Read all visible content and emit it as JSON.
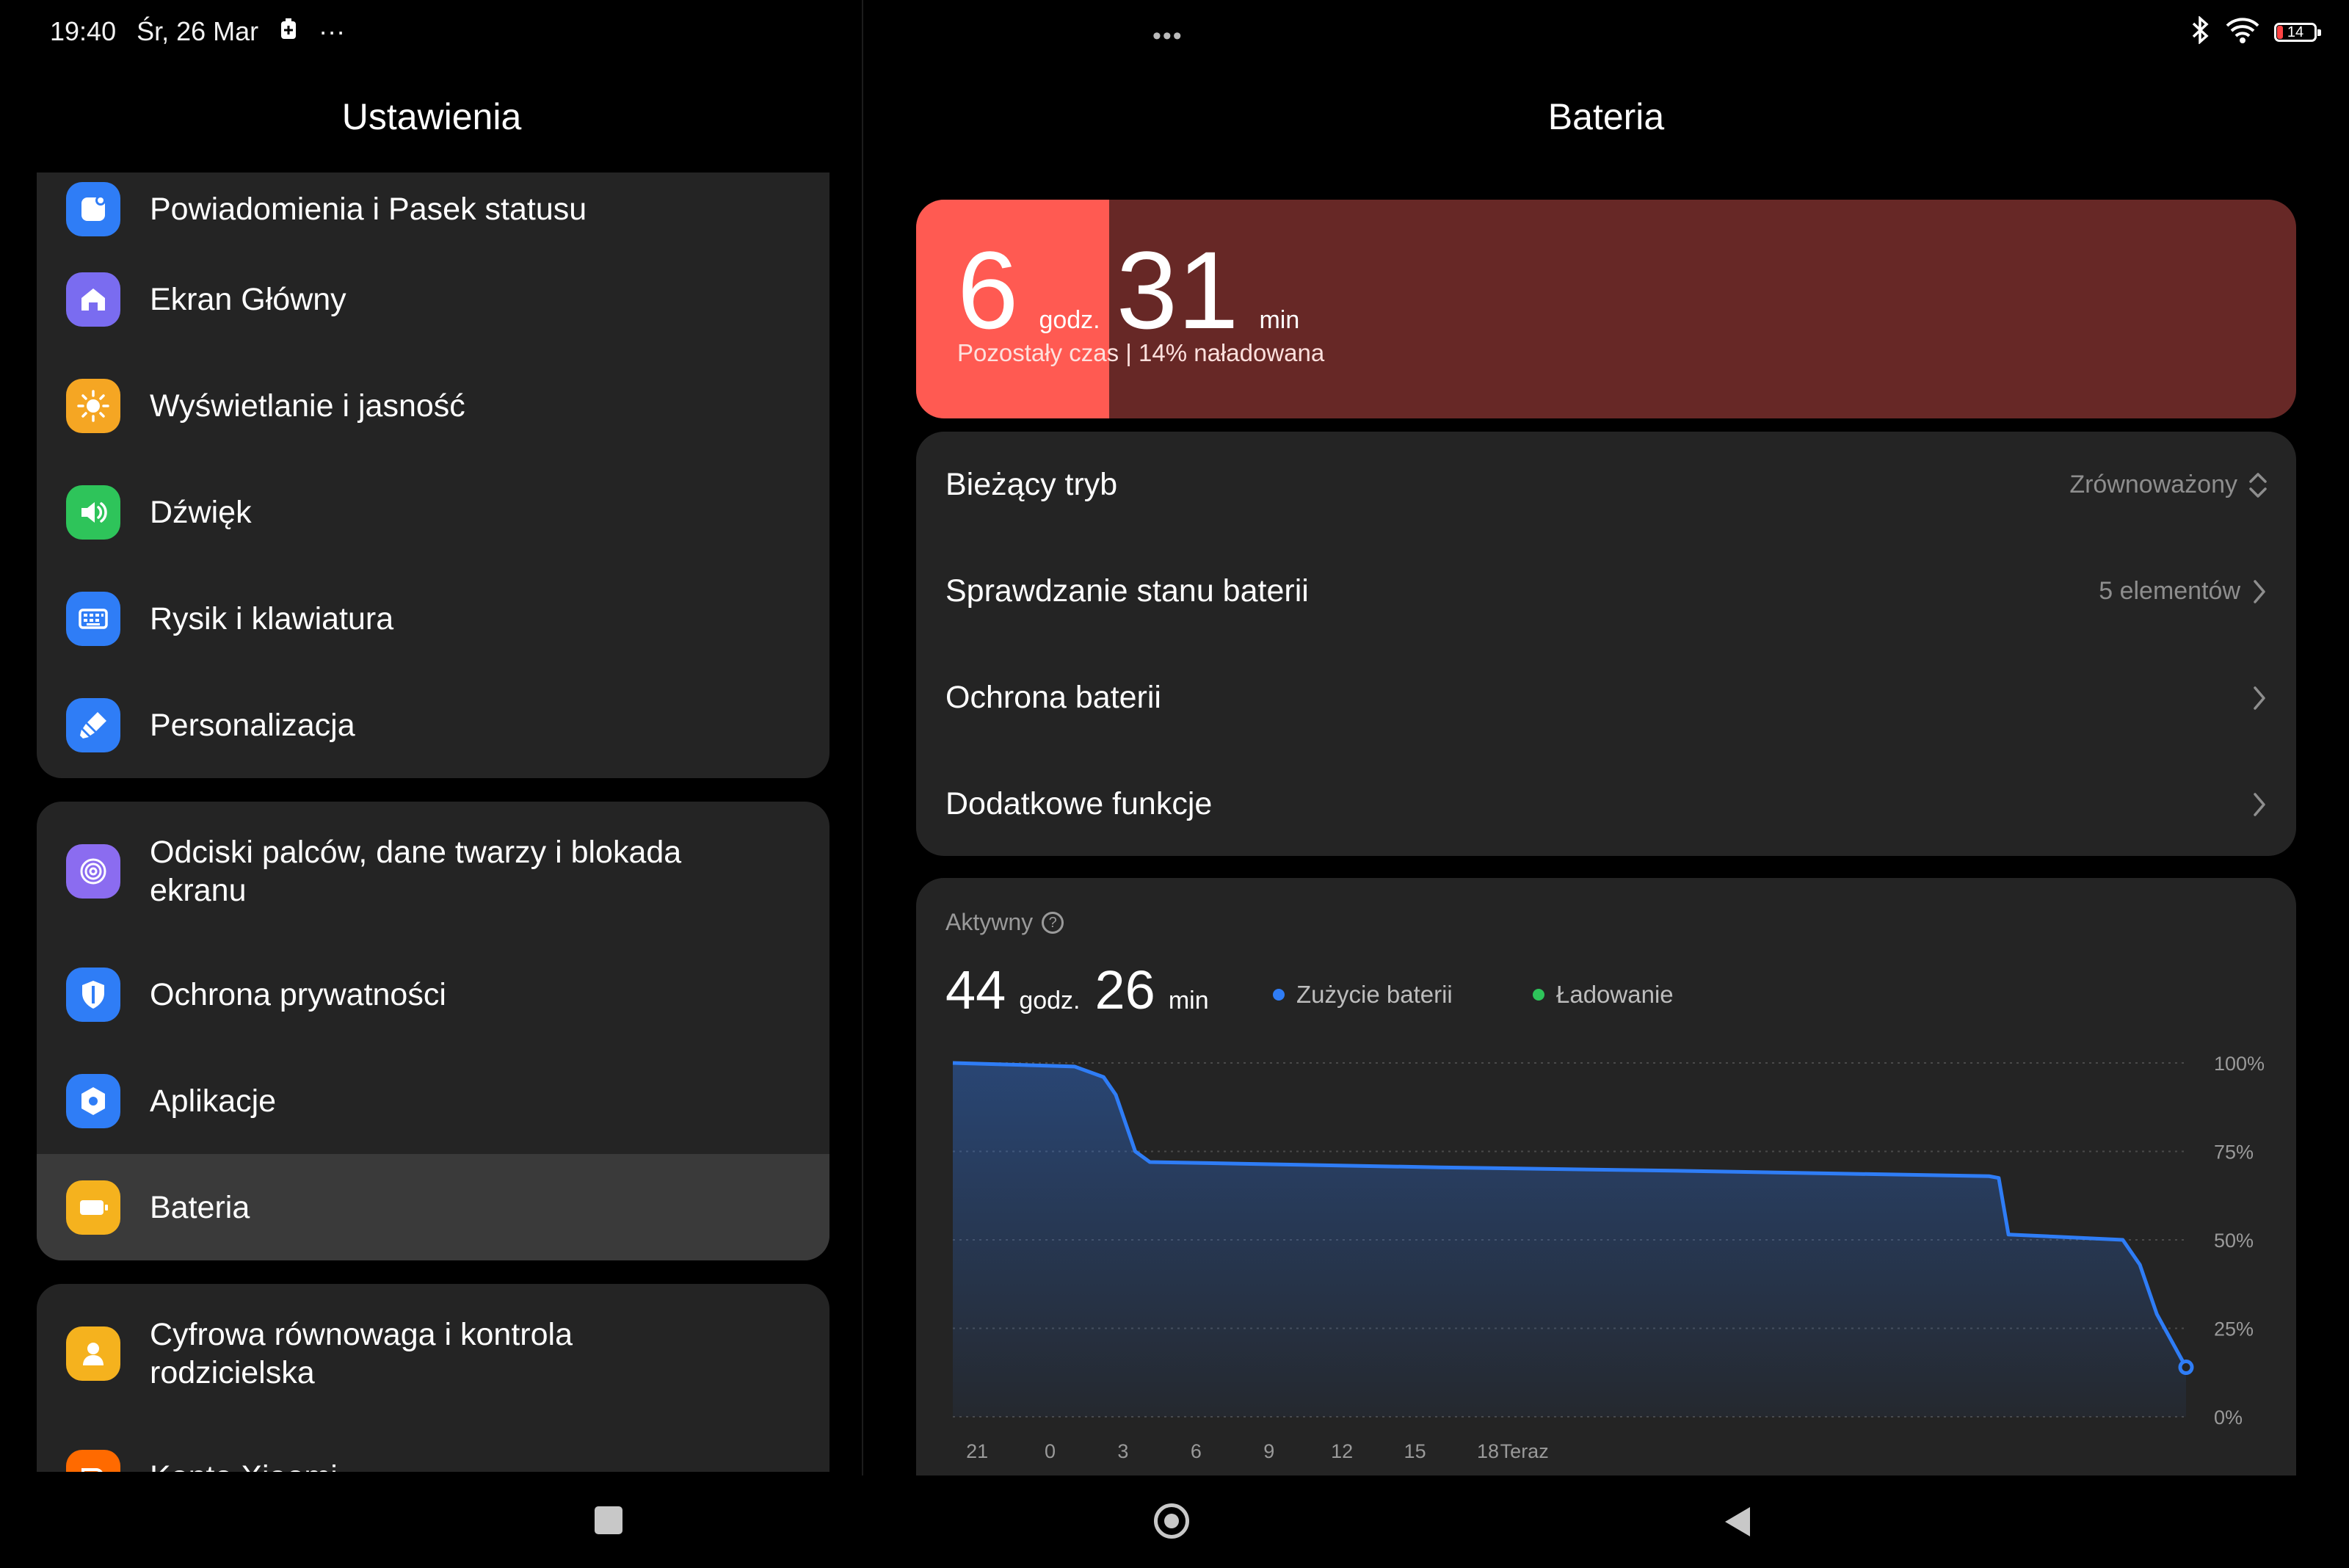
{
  "status_bar": {
    "time": "19:40",
    "date": "Śr, 26 Mar",
    "more": "···",
    "battery_level": "14",
    "icons": [
      "battery-saver-icon",
      "bluetooth-icon",
      "wifi-icon",
      "battery-icon"
    ]
  },
  "left_pane": {
    "title": "Ustawienia",
    "groups": [
      [
        {
          "label": "Powiadomienia i Pasek statusu",
          "icon": "notification-icon",
          "color": "#2f7df6"
        },
        {
          "label": "Ekran Główny",
          "icon": "home-icon",
          "color": "#7a6cf0"
        },
        {
          "label": "Wyświetlanie i jasność",
          "icon": "sun-icon",
          "color": "#f5a623"
        },
        {
          "label": "Dźwięk",
          "icon": "speaker-icon",
          "color": "#2ec45a"
        },
        {
          "label": "Rysik i klawiatura",
          "icon": "keyboard-icon",
          "color": "#2f7df6"
        },
        {
          "label": "Personalizacja",
          "icon": "brush-icon",
          "color": "#2f7df6"
        }
      ],
      [
        {
          "label": "Odciski palców, dane twarzy i blokada ekranu",
          "icon": "fingerprint-icon",
          "color": "#8b6cf0"
        },
        {
          "label": "Ochrona prywatności",
          "icon": "shield-icon",
          "color": "#2f7df6"
        },
        {
          "label": "Aplikacje",
          "icon": "gear-icon",
          "color": "#2f7df6"
        },
        {
          "label": "Bateria",
          "icon": "battery-icon",
          "color": "#f5b21e",
          "active": true
        }
      ],
      [
        {
          "label": "Cyfrowa równowaga i kontrola rodzicielska",
          "icon": "wellbeing-icon",
          "color": "#f5b21e"
        },
        {
          "label": "Konto Xiaomi",
          "icon": "mi-icon",
          "color": "#ff6a00"
        }
      ]
    ]
  },
  "right_pane": {
    "title": "Bateria",
    "remaining": {
      "hours": "6",
      "hours_unit": "godz.",
      "minutes": "31",
      "minutes_unit": "min",
      "subtitle": "Pozostały czas | 14% naładowana",
      "level_percent": 14
    },
    "settings": [
      {
        "label": "Bieżący tryb",
        "value": "Zrównoważony",
        "control": "updown"
      },
      {
        "label": "Sprawdzanie stanu baterii",
        "value": "5 elementów",
        "control": "chevron"
      },
      {
        "label": "Ochrona baterii",
        "value": "",
        "control": "chevron"
      },
      {
        "label": "Dodatkowe funkcje",
        "value": "",
        "control": "chevron"
      }
    ],
    "usage": {
      "header": "Aktywny",
      "hours": "44",
      "hours_unit": "godz.",
      "minutes": "26",
      "minutes_unit": "min",
      "legend": [
        {
          "name": "Zużycie baterii",
          "color": "#2f7df6"
        },
        {
          "name": "Ładowanie",
          "color": "#2ec45a"
        }
      ]
    }
  },
  "chart_data": {
    "type": "area",
    "title": "",
    "xlabel": "",
    "ylabel": "",
    "x_ticks": [
      "21",
      "0",
      "3",
      "6",
      "9",
      "12",
      "15",
      "18",
      "Teraz"
    ],
    "y_ticks": [
      "100%",
      "75%",
      "50%",
      "25%",
      "0%"
    ],
    "ylim": [
      0,
      100
    ],
    "grid": true,
    "series": [
      {
        "name": "Zużycie baterii",
        "color": "#2f7df6",
        "x": [
          20.0,
          25.0,
          26.2,
          26.7,
          27.5,
          28.1,
          32,
          40,
          50,
          62.6,
          63.0,
          63.4,
          65,
          68.1,
          68.8,
          69.5,
          70.7
        ],
        "y": [
          100,
          99,
          96,
          91,
          75,
          72,
          71.5,
          70.5,
          69.5,
          68,
          67.5,
          51.5,
          51,
          50,
          43,
          29,
          14
        ]
      }
    ]
  }
}
